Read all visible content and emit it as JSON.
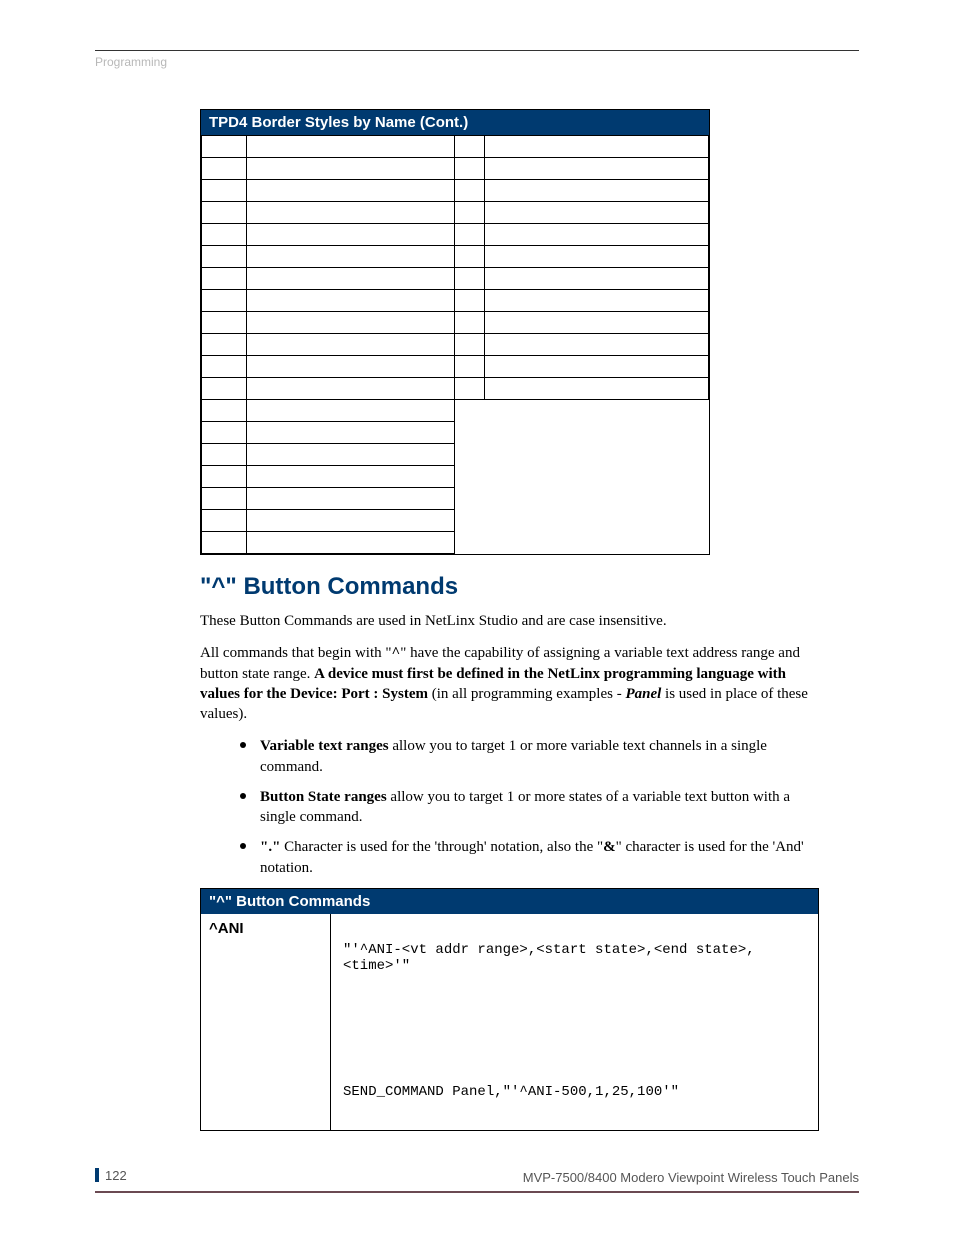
{
  "header": {
    "section": "Programming"
  },
  "table1": {
    "title": "TPD4 Border Styles by Name (Cont.)",
    "full_rows": 12,
    "short_rows": 7
  },
  "heading": "\"^\" Button Commands",
  "para1": "These Button Commands are used in NetLinx Studio and are case insensitive.",
  "para2_pre": "All commands that begin with \"",
  "para2_caret": "^",
  "para2_mid": "\" have the capability of assigning a variable text address range and button state range. ",
  "para2_bold": "A device must first be defined in the NetLinx programming language with values for the Device: Port : System",
  "para2_post1": " (in all programming examples - ",
  "para2_panel": "Panel",
  "para2_post2": " is used in place of these values).",
  "bullets": {
    "b1_bold": "Variable text ranges",
    "b1_rest": " allow you to target 1 or more variable text channels in a single command.",
    "b2_bold": "Button State ranges",
    "b2_rest": " allow you to target 1 or more states of a variable text button with a single command.",
    "b3_q1": "\".\"",
    "b3_mid": " Character is used for the 'through' notation, also the \"",
    "b3_amp": "&",
    "b3_end": "\" character is used for the 'And' notation."
  },
  "cmd_table": {
    "title": "\"^\" Button Commands",
    "cmd_name": "^ANI",
    "syntax": "\"'^ANI-<vt addr range>,<start state>,<end state>,<time>'\"",
    "example": "SEND_COMMAND Panel,\"'^ANI-500,1,25,100'\""
  },
  "footer": {
    "page": "122",
    "title": "MVP-7500/8400 Modero Viewpoint Wireless Touch Panels"
  }
}
